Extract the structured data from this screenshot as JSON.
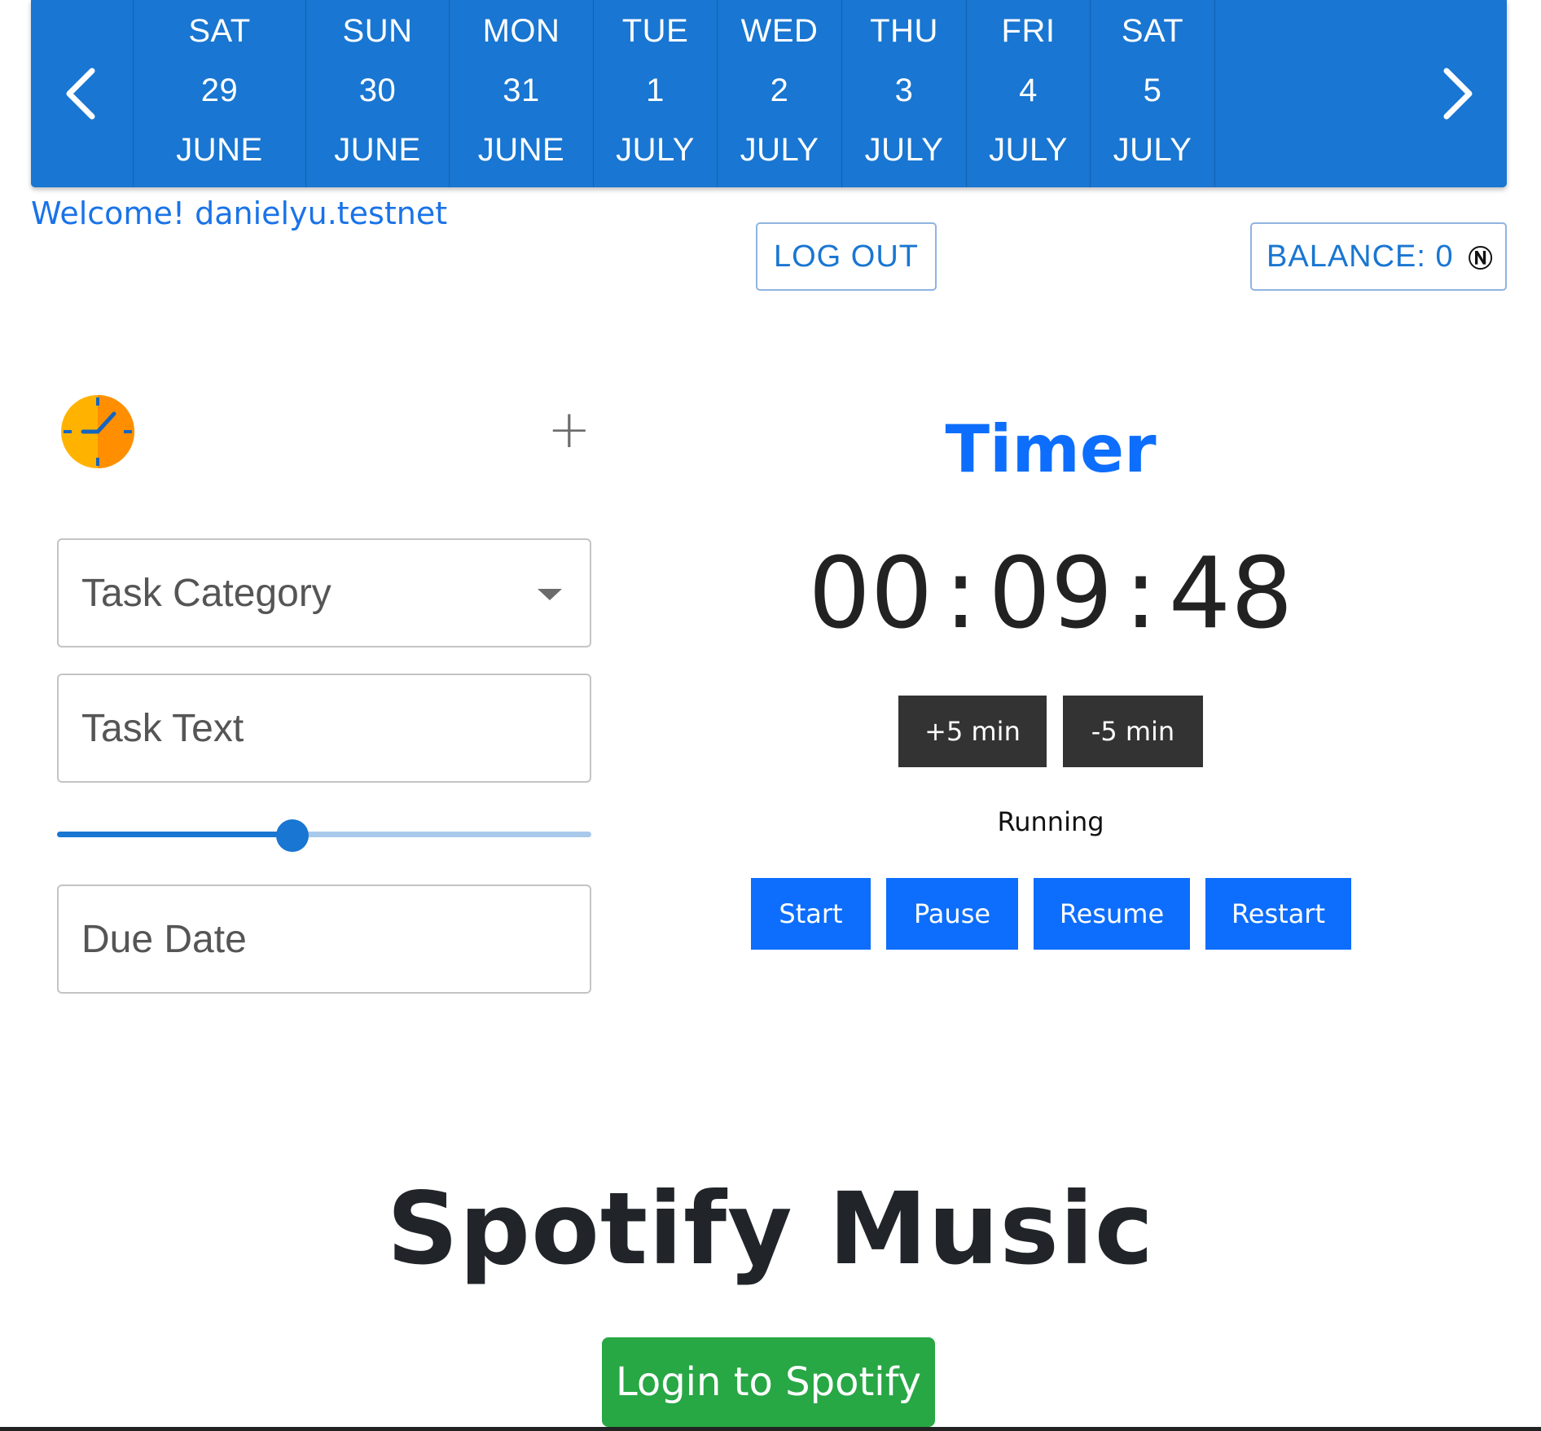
{
  "datebar": {
    "days": [
      {
        "weekday": "SAT",
        "date": "29",
        "month": "JUNE"
      },
      {
        "weekday": "SUN",
        "date": "30",
        "month": "JUNE"
      },
      {
        "weekday": "MON",
        "date": "31",
        "month": "JUNE"
      },
      {
        "weekday": "TUE",
        "date": "1",
        "month": "JULY"
      },
      {
        "weekday": "WED",
        "date": "2",
        "month": "JULY"
      },
      {
        "weekday": "THU",
        "date": "3",
        "month": "JULY"
      },
      {
        "weekday": "FRI",
        "date": "4",
        "month": "JULY"
      },
      {
        "weekday": "SAT",
        "date": "5",
        "month": "JULY"
      }
    ],
    "prev_icon": "chevron-left-icon",
    "next_icon": "chevron-right-icon"
  },
  "header": {
    "welcome": "Welcome! danielyu.testnet",
    "logout_label": "LOG OUT",
    "balance_label": "BALANCE: 0",
    "currency_symbol": "Ⓝ"
  },
  "task_form": {
    "clock_icon": "clock-icon",
    "add_icon": "plus-icon",
    "category_placeholder": "Task Category",
    "text_placeholder": "Task Text",
    "slider_value_fraction": 0.44,
    "due_date_placeholder": "Due Date"
  },
  "timer": {
    "title": "Timer",
    "hours": "00",
    "minutes": "09",
    "seconds": "48",
    "separator": ":",
    "plus_label": "+5 min",
    "minus_label": "-5 min",
    "status": "Running",
    "start_label": "Start",
    "pause_label": "Pause",
    "resume_label": "Resume",
    "restart_label": "Restart"
  },
  "spotify": {
    "title": "Spotify Music",
    "login_label": "Login to Spotify"
  },
  "colors": {
    "datebar_bg": "#1976d2",
    "primary_blue": "#0d6efd",
    "dark_button": "#333333",
    "spotify_green": "#28a745",
    "clock_orange": "#ff9800"
  }
}
